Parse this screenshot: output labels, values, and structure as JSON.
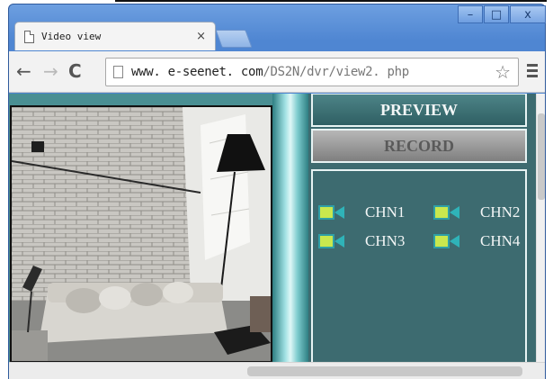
{
  "window": {
    "minimize_glyph": "–",
    "maximize_glyph": "□",
    "close_glyph": "x"
  },
  "tab": {
    "title": "Video view",
    "close_glyph": "×"
  },
  "toolbar": {
    "back_glyph": "←",
    "forward_glyph": "→",
    "reload_glyph": "C",
    "url_host": "www. e-seenet. com",
    "url_path": "/DS2N/dvr/view2. php",
    "star_glyph": "☆"
  },
  "panel": {
    "preview_label": "PREVIEW",
    "record_label": "RECORD",
    "channels": [
      {
        "label": "CHN1",
        "icon": "camera-icon"
      },
      {
        "label": "CHN2",
        "icon": "camera-icon"
      },
      {
        "label": "CHN3",
        "icon": "camera-icon"
      },
      {
        "label": "CHN4",
        "icon": "camera-icon"
      }
    ]
  },
  "colors": {
    "content_bg": "#4a8f93",
    "panel_bg": "#3d6b70",
    "preview_button": "#3e7175",
    "record_button": "#9a9a9a",
    "camera_icon": "#c9e84e",
    "window_frame": "#5a8fd8"
  }
}
